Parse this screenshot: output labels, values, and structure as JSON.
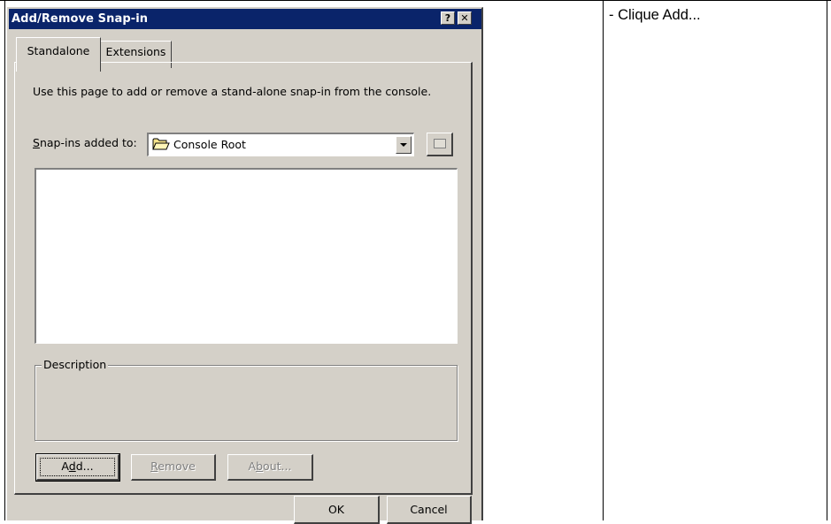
{
  "dialog": {
    "title": "Add/Remove Snap-in",
    "help_button": "?",
    "close_button": "✕",
    "tabs": [
      {
        "label": "Standalone",
        "active": true
      },
      {
        "label": "Extensions",
        "active": false
      }
    ],
    "intro_text": "Use this page to add or remove a stand-alone snap-in from the console.",
    "snapins_label_prefix": "S",
    "snapins_label_rest": "nap-ins added to:",
    "combo": {
      "icon": "folder-icon",
      "value": "Console Root"
    },
    "description_label": "Description",
    "buttons": {
      "add_a": "A",
      "add_d": "d",
      "add_rest": "d...",
      "remove_prefix": "R",
      "remove_rest": "emove",
      "about_a": "A",
      "about_b": "b",
      "about_rest": "out...",
      "ok": "OK",
      "cancel": "Cancel"
    }
  },
  "instruction": "- Clique Add...",
  "colors": {
    "titlebar": "#0a246a",
    "dialog_face": "#d4d0c8",
    "disabled_text": "#808080"
  }
}
